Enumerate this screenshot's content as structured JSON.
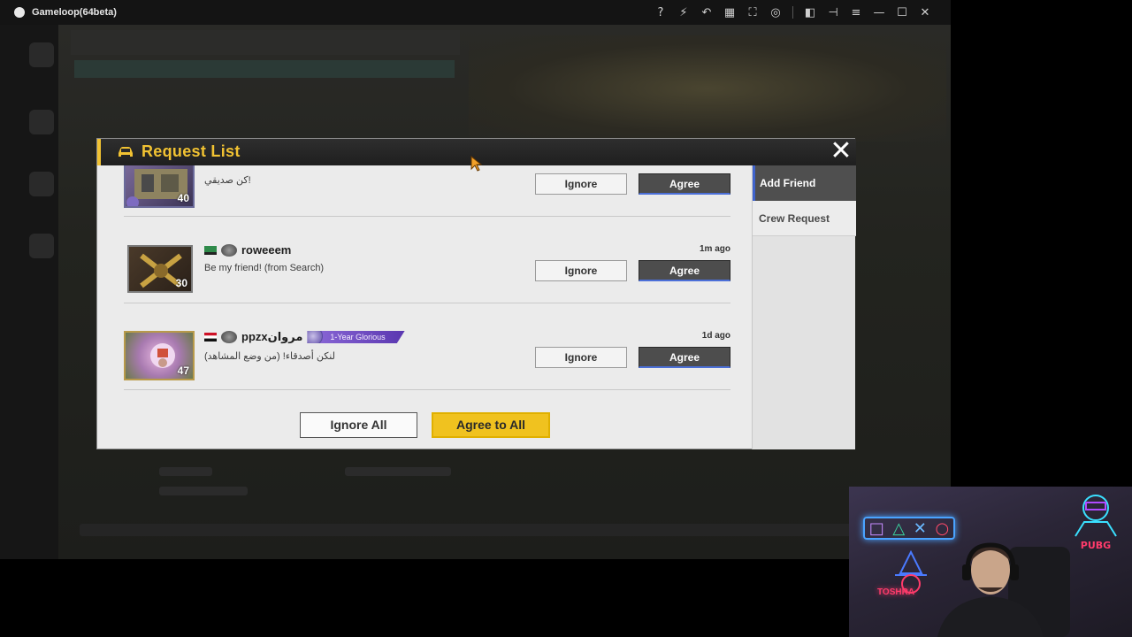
{
  "window": {
    "app_title": "Gameloop(64beta)",
    "toolbar_icons": [
      "help-icon",
      "boost-icon",
      "undo-icon",
      "keyboard-icon",
      "fullscreen-icon",
      "gamepad-icon",
      "sidebar-icon",
      "pin-icon",
      "menu-icon",
      "minimize-icon",
      "maximize-icon",
      "close-icon"
    ]
  },
  "modal": {
    "title": "Request List",
    "close_glyph": "✕",
    "tabs": [
      {
        "label": "Add Friend",
        "active": true
      },
      {
        "label": "Crew Request",
        "active": false
      }
    ],
    "requests": [
      {
        "name": "",
        "level": "40",
        "message": "كن صديقي!",
        "time": "",
        "ignore_label": "Ignore",
        "agree_label": "Agree"
      },
      {
        "name": "roweeem",
        "level": "30",
        "message": "Be my friend! (from Search)",
        "time": "1m ago",
        "ignore_label": "Ignore",
        "agree_label": "Agree"
      },
      {
        "name": "ppzxمروان",
        "level": "47",
        "badge": "1-Year Glorious",
        "message": "لنكن أصدقاء! (من وضع المشاهد)",
        "time": "1d ago",
        "ignore_label": "Ignore",
        "agree_label": "Agree"
      }
    ],
    "ignore_all_label": "Ignore All",
    "agree_all_label": "Agree to All"
  },
  "overlay": {
    "neon_sign": "TOSHRA",
    "neon_pubg": "PUBG"
  },
  "colors": {
    "accent_yellow": "#f1c232",
    "agree_bg": "#4d4d4d",
    "tab_active_bar": "#3f63cc",
    "modal_bg": "#ebebeb"
  }
}
